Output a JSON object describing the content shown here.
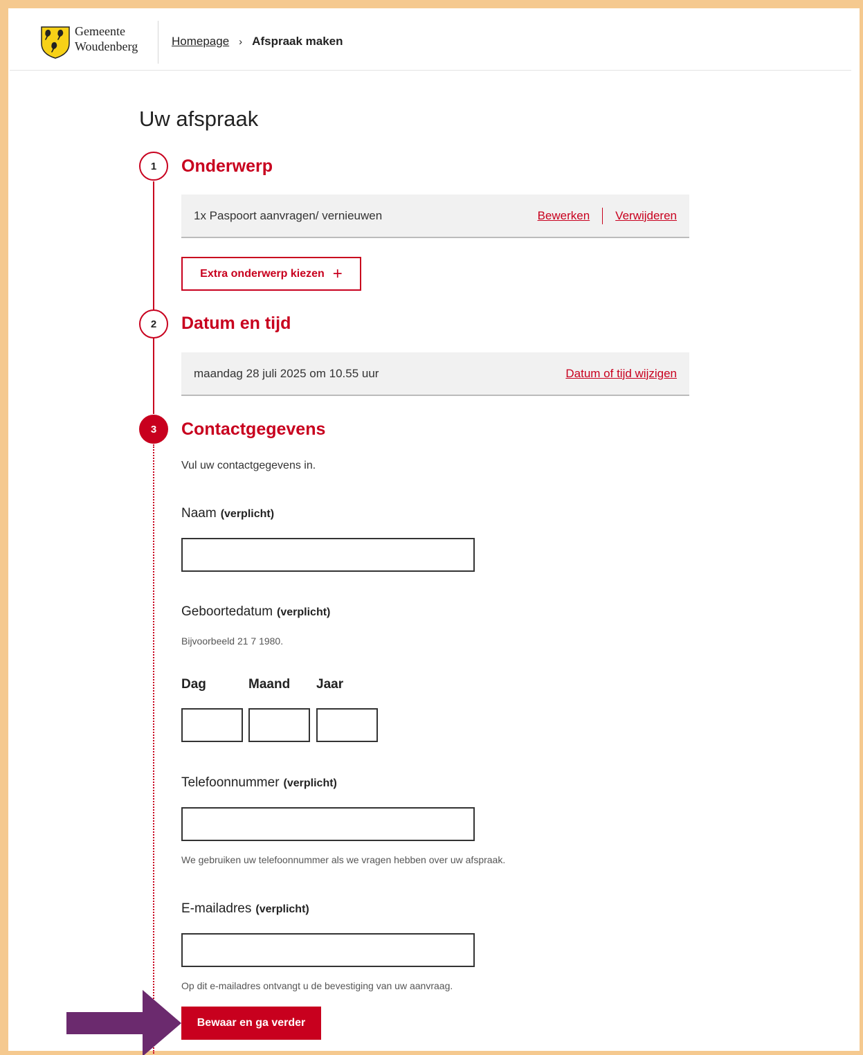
{
  "header": {
    "logo_line1": "Gemeente",
    "logo_line2": "Woudenberg",
    "breadcrumb_home": "Homepage",
    "breadcrumb_sep": "›",
    "breadcrumb_current": "Afspraak maken"
  },
  "page_title": "Uw afspraak",
  "steps": [
    {
      "number": "1",
      "title": "Onderwerp",
      "summary": "1x Paspoort aanvragen/ vernieuwen",
      "edit_link": "Bewerken",
      "delete_link": "Verwijderen",
      "extra_button": "Extra onderwerp kiezen",
      "extra_button_icon": "+"
    },
    {
      "number": "2",
      "title": "Datum en tijd",
      "summary": "maandag 28 juli 2025 om 10.55 uur",
      "change_link": "Datum of tijd wijzigen"
    },
    {
      "number": "3",
      "title": "Contactgegevens",
      "intro": "Vul uw contactgegevens in."
    }
  ],
  "form": {
    "name": {
      "label": "Naam",
      "required": "(verplicht)",
      "value": ""
    },
    "birthdate": {
      "label": "Geboortedatum",
      "required": "(verplicht)",
      "hint": "Bijvoorbeeld 21 7 1980.",
      "day_label": "Dag",
      "month_label": "Maand",
      "year_label": "Jaar"
    },
    "phone": {
      "label": "Telefoonnummer",
      "required": "(verplicht)",
      "hint": "We gebruiken uw telefoonnummer als we vragen hebben over uw afspraak."
    },
    "email": {
      "label": "E-mailadres",
      "required": "(verplicht)",
      "hint": "Op dit e-mailadres ontvangt u de bevestiging van uw aanvraag."
    },
    "submit": "Bewaar en ga verder"
  },
  "colors": {
    "accent": "#c8001e",
    "page_border": "#f5c98f",
    "annotation_arrow": "#6b2a6e",
    "logo_shield": "#f7d117"
  },
  "icons": [
    "logo-shield-icon",
    "breadcrumb-chevron-icon",
    "plus-icon",
    "annotation-arrow-icon"
  ]
}
